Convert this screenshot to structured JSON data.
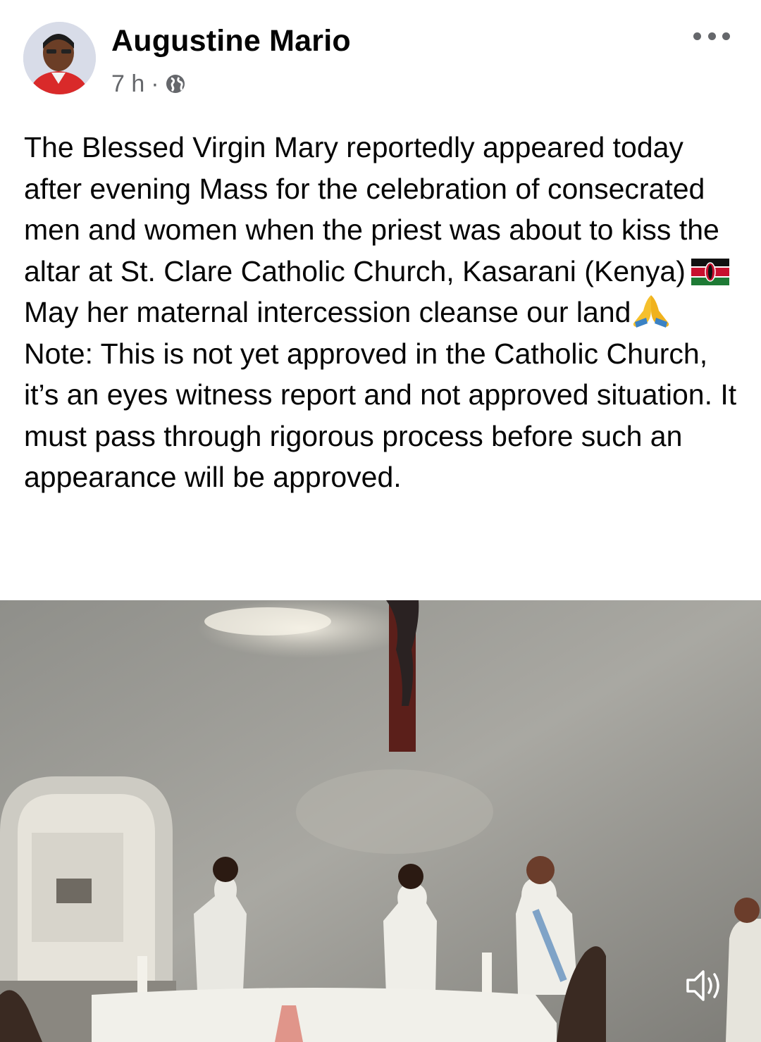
{
  "post": {
    "author_name": "Augustine Mario",
    "timestamp": "7 h",
    "separator": "·",
    "privacy_icon": "globe-icon",
    "more_icon": "more-dots-icon",
    "paragraphs": [
      "The Blessed Virgin Mary reportedly appeared today after evening Mass for the celebration of consecrated men and women when the priest was about to kiss the altar at St. Clare Catholic Church, Kasarani (Kenya)",
      "May her maternal intercession cleanse our land",
      "Note: This is not yet approved in the Catholic Church, it’s an eyes witness report and not approved situation. It must pass through rigorous process before such an appearance will be approved."
    ],
    "emoji": {
      "flag": "kenya-flag-icon",
      "hands": "folded-hands-icon"
    }
  },
  "media": {
    "type": "video",
    "sound_icon": "speaker-icon",
    "description_icon": "video-thumbnail"
  }
}
